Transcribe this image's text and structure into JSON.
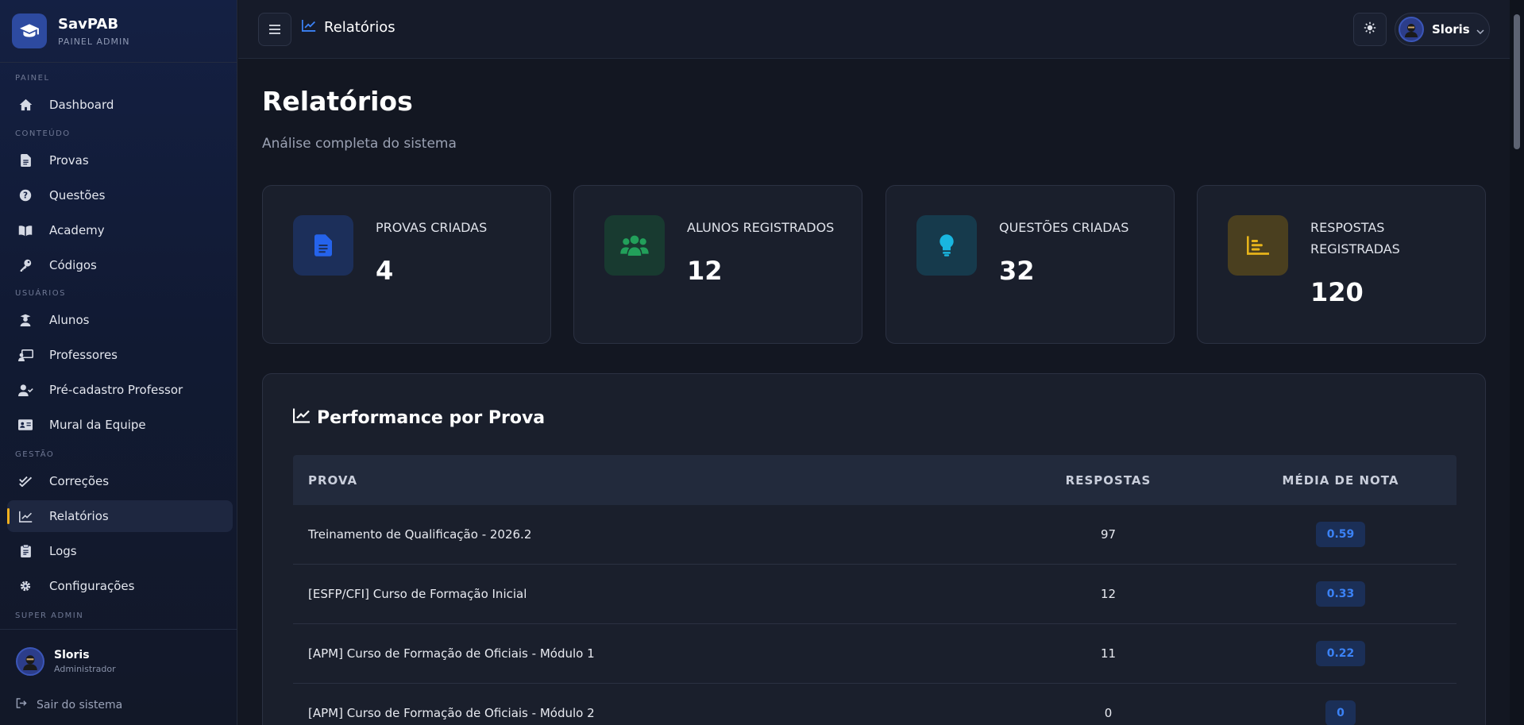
{
  "brand": {
    "name": "SavPAB",
    "subtitle": "PAINEL ADMIN"
  },
  "sidebar": {
    "sections": [
      {
        "label": "PAINEL"
      },
      {
        "label": "CONTEÚDO"
      },
      {
        "label": "USUÁRIOS"
      },
      {
        "label": "GESTÃO"
      },
      {
        "label": "SUPER ADMIN"
      }
    ],
    "items": [
      {
        "label": "Dashboard",
        "icon": "home-icon"
      },
      {
        "label": "Provas",
        "icon": "file-icon"
      },
      {
        "label": "Questões",
        "icon": "question-icon"
      },
      {
        "label": "Academy",
        "icon": "book-icon"
      },
      {
        "label": "Códigos",
        "icon": "key-icon"
      },
      {
        "label": "Alunos",
        "icon": "student-icon"
      },
      {
        "label": "Professores",
        "icon": "teacher-icon"
      },
      {
        "label": "Pré-cadastro Professor",
        "icon": "user-check-icon"
      },
      {
        "label": "Mural da Equipe",
        "icon": "id-card-icon"
      },
      {
        "label": "Correções",
        "icon": "check-double-icon"
      },
      {
        "label": "Relatórios",
        "icon": "chart-line-icon",
        "active": true
      },
      {
        "label": "Logs",
        "icon": "clipboard-icon"
      },
      {
        "label": "Configurações",
        "icon": "gear-icon"
      }
    ],
    "user": {
      "name": "Sloris",
      "role": "Administrador"
    },
    "logout_label": "Sair do sistema"
  },
  "topbar": {
    "title": "Relatórios",
    "user_name": "Sloris"
  },
  "page": {
    "title": "Relatórios",
    "subtitle": "Análise completa do sistema"
  },
  "stats": [
    {
      "label": "PROVAS CRIADAS",
      "value": "4",
      "icon": "file-icon",
      "color": "#2563eb"
    },
    {
      "label": "ALUNOS REGISTRADOS",
      "value": "12",
      "icon": "users-icon",
      "color": "#22a05a"
    },
    {
      "label": "QUESTÕES CRIADAS",
      "value": "32",
      "icon": "lightbulb-icon",
      "color": "#19b6e0"
    },
    {
      "label": "RESPOSTAS REGISTRADAS",
      "value": "120",
      "icon": "bar-chart-icon",
      "color": "#e7b41a"
    }
  ],
  "performance": {
    "title": "Performance por Prova",
    "columns": [
      "PROVA",
      "RESPOSTAS",
      "MÉDIA DE NOTA"
    ],
    "rows": [
      {
        "prova": "Treinamento de Qualificação - 2026.2",
        "respostas": "97",
        "media": "0.59"
      },
      {
        "prova": "[ESFP/CFI] Curso de Formação Inicial",
        "respostas": "12",
        "media": "0.33"
      },
      {
        "prova": "[APM] Curso de Formação de Oficiais - Módulo 1",
        "respostas": "11",
        "media": "0.22"
      },
      {
        "prova": "[APM] Curso de Formação de Oficiais - Módulo 2",
        "respostas": "0",
        "media": "0"
      }
    ]
  }
}
